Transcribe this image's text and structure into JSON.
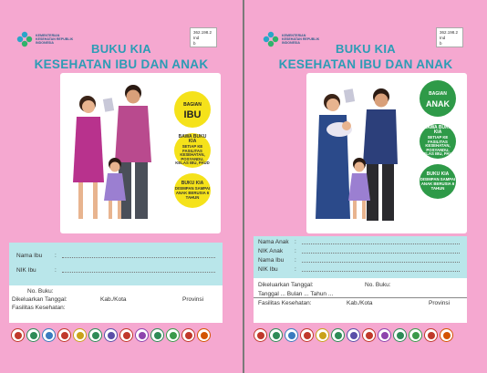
{
  "left": {
    "ministry": "KEMENTERIAN KESEHATAN REPUBLIK INDONESIA",
    "code": [
      "362.198.2",
      "Ind",
      "b"
    ],
    "title_line1": "BUKU KIA",
    "title_line2": "KESEHATAN IBU DAN ANAK",
    "badge_main": {
      "small": "BAGIAN",
      "big": "IBU",
      "color": "#f5e21a"
    },
    "badge_1": {
      "title": "BAWA BUKU KIA",
      "text": "SETIAP KE FASILITAS KESEHATAN, POSYANDU, KELAS IBU, PAUD",
      "color": "#f5e21a"
    },
    "badge_2": {
      "title": "BUKU KIA",
      "text": "DISIMPAN SAMPAI ANAK BERUSIA 6 TAHUN",
      "color": "#f5e21a"
    },
    "fields": [
      {
        "label": "Nama Ibu",
        "sep": ":"
      },
      {
        "label": "NIK Ibu",
        "sep": ":"
      }
    ],
    "no_buku": "No. Buku:",
    "dikeluarkan": "Dikeluarkan Tanggal:",
    "kab": "Kab./Kota",
    "provinsi": "Provinsi",
    "fasilitas": "Fasilitas Kesehatan:"
  },
  "right": {
    "ministry": "KEMENTERIAN KESEHATAN REPUBLIK INDONESIA",
    "code": [
      "362.198.2",
      "Ind",
      "b"
    ],
    "title_line1": "BUKU KIA",
    "title_line2": "KESEHATAN IBU DAN ANAK",
    "badge_main": {
      "small": "BAGIAN",
      "big": "ANAK",
      "color": "#2e9a48"
    },
    "badge_1": {
      "title": "BAWA BUKU KIA",
      "text": "SETIAP KE FASILITAS KESEHATAN, POSYANDU, KELAS IBU, PAUD",
      "color": "#2e9a48"
    },
    "badge_2": {
      "title": "BUKU KIA",
      "text": "DISIMPAN SAMPAI ANAK BERUSIA 6 TAHUN",
      "color": "#2e9a48"
    },
    "fields": [
      {
        "label": "Nama Anak",
        "sep": ":"
      },
      {
        "label": "NIK Anak",
        "sep": ":"
      },
      {
        "label": "Nama Ibu",
        "sep": ":"
      },
      {
        "label": "NIK Ibu",
        "sep": ":"
      }
    ],
    "dikeluarkan": "Dikeluarkan Tanggal:",
    "no_buku": "No. Buku:",
    "tanggal_line": "Tanggal ... Bulan ... Tahun ...",
    "fasilitas": "Fasilitas Kesehatan:",
    "kab": "Kab./Kota",
    "provinsi": "Provinsi"
  },
  "seals": [
    {
      "icon": "pkk-seal-icon",
      "color": "#c0392b"
    },
    {
      "icon": "garuda-seal-icon",
      "color": "#2e8b57"
    },
    {
      "icon": "tut-wuri-seal-icon",
      "color": "#3a7bbf"
    },
    {
      "icon": "star-seal-icon",
      "color": "#c0392b"
    },
    {
      "icon": "gold-seal-icon",
      "color": "#c9a21a"
    },
    {
      "icon": "green-seal-icon",
      "color": "#2e8b57"
    },
    {
      "icon": "blue-seal-icon",
      "color": "#5a4fa8"
    },
    {
      "icon": "torch-seal-icon",
      "color": "#c0392b"
    },
    {
      "icon": "emblem-seal-icon",
      "color": "#8e44ad"
    },
    {
      "icon": "cross-seal-icon",
      "color": "#2e8b57"
    },
    {
      "icon": "idai-seal-icon",
      "color": "#3a9a4a"
    },
    {
      "icon": "pink-seal-icon",
      "color": "#c0392b"
    },
    {
      "icon": "ibi-seal-icon",
      "color": "#d35400"
    }
  ]
}
